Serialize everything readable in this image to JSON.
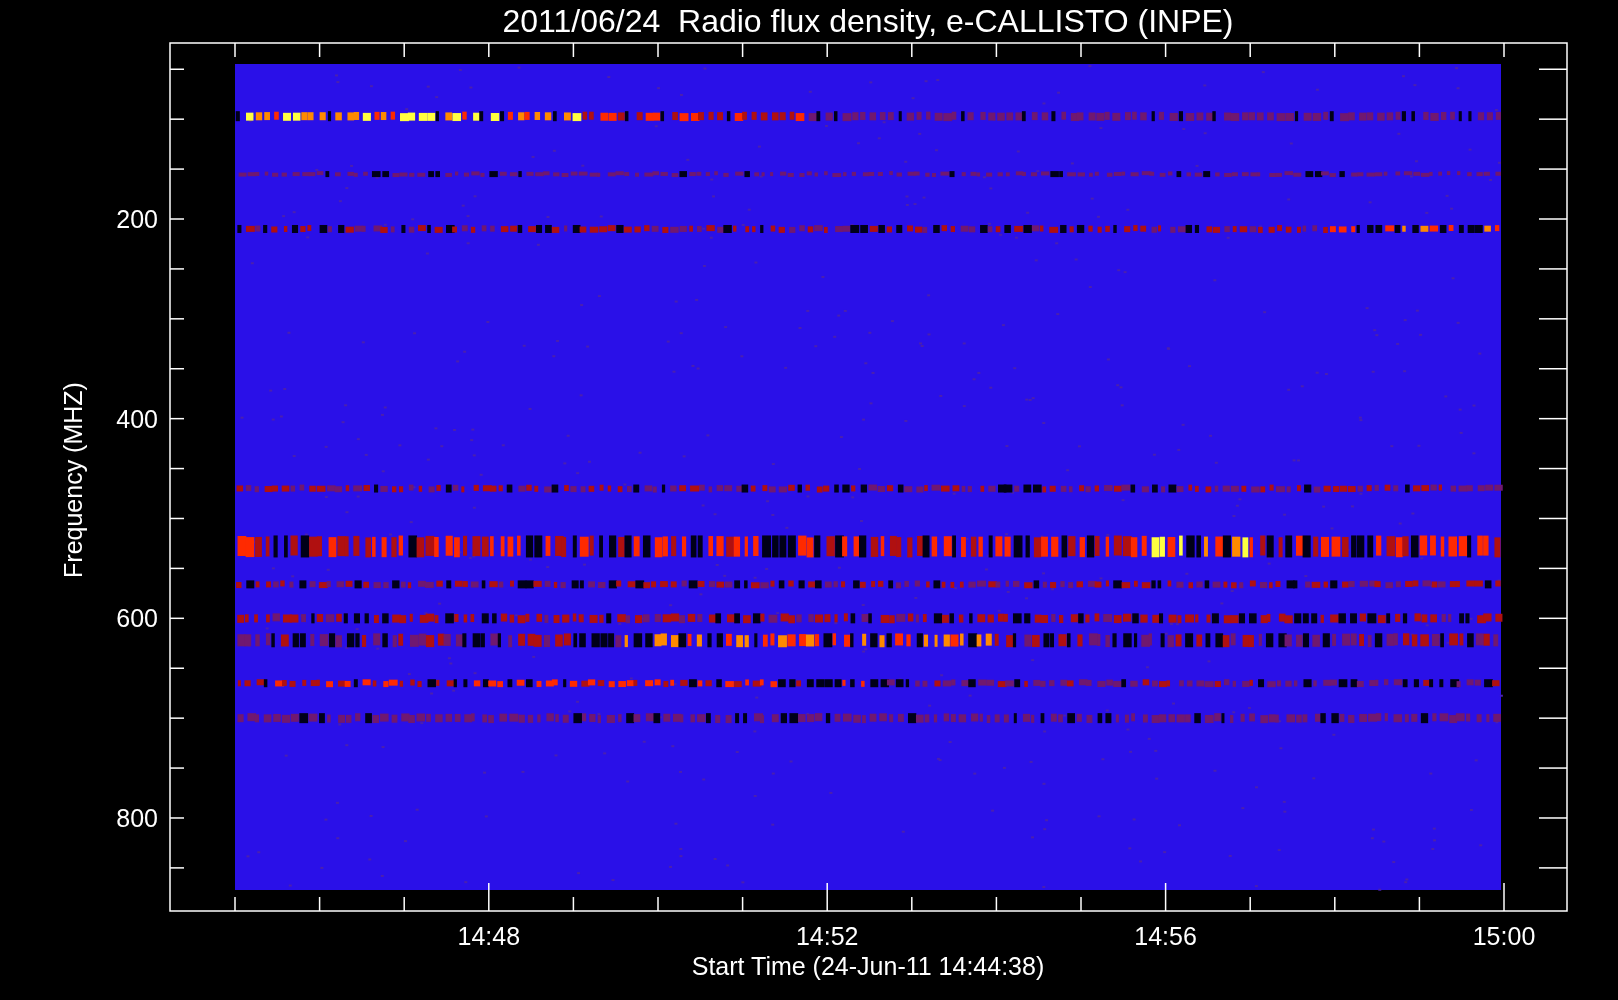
{
  "title": "2011/06/24  Radio flux density, e-CALLISTO (INPE)",
  "plot": {
    "ylabel": "Frequency (MHZ)",
    "xlabel": "Start Time (24-Jun-11 14:44:38)",
    "yticks": [
      "200",
      "400",
      "600",
      "800"
    ],
    "xticks": [
      "14:48",
      "14:52",
      "14:56",
      "15:00"
    ]
  }
}
